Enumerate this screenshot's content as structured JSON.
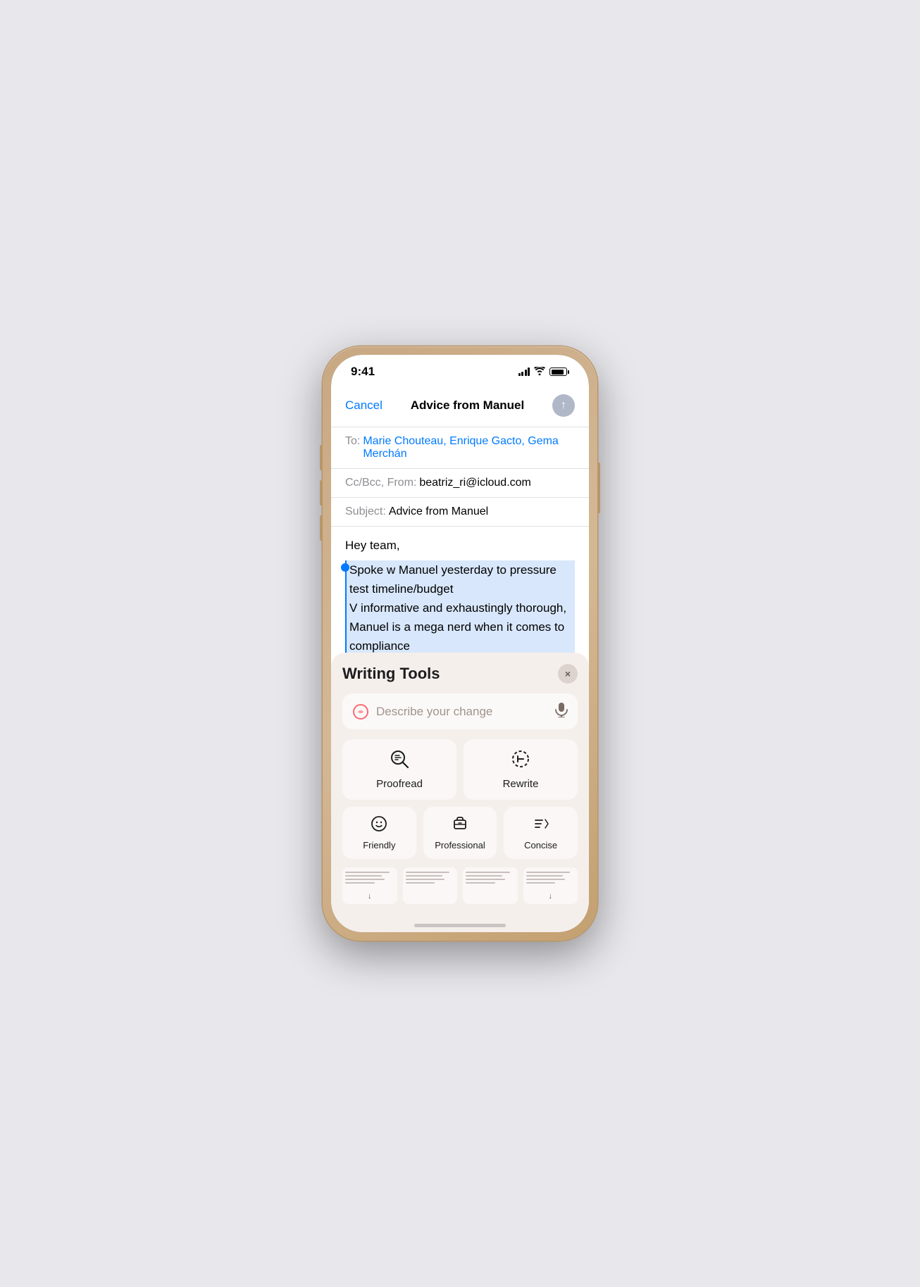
{
  "phone": {
    "status_bar": {
      "time": "9:41",
      "signal_label": "signal",
      "wifi_label": "wifi",
      "battery_label": "battery"
    },
    "compose": {
      "cancel_label": "Cancel",
      "title": "Advice from Manuel",
      "to_label": "To:",
      "recipients": "Marie Chouteau, Enrique Gacto, Gema Merchán",
      "cc_label": "Cc/Bcc, From:",
      "from_value": "beatriz_ri@icloud.com",
      "subject_label": "Subject:",
      "subject_value": "Advice from Manuel",
      "greeting": "Hey team,",
      "body_selected": "Spoke w Manuel yesterday to pressure test timeline/budget\nV informative and exhaustingly thorough, Manuel is a mega nerd when it comes to compliance\nBig takeaway was timeline is realistic, we can commit with confidence, woo!\nM's firm specializes in community consultation, we need help here, should consider engaging them for comms/for..."
    },
    "writing_tools": {
      "title": "Writing Tools",
      "close_label": "×",
      "input_placeholder": "Describe your change",
      "mic_label": "mic",
      "proofread_label": "Proofread",
      "rewrite_label": "Rewrite",
      "friendly_label": "Friendly",
      "professional_label": "Professional",
      "concise_label": "Concise",
      "thumb1_arrow": "↓",
      "thumb2_arrow": "",
      "thumb3_arrow": "",
      "thumb4_arrow": "↓"
    }
  }
}
